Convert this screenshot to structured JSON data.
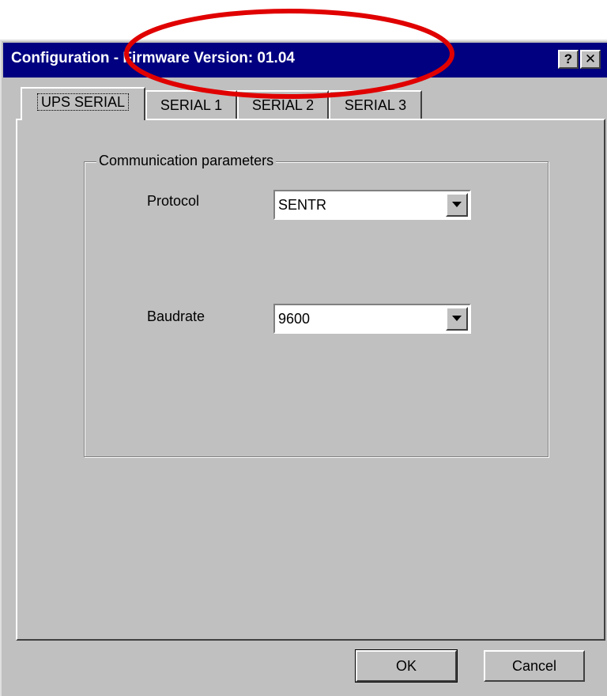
{
  "window": {
    "title": "Configuration - Firmware Version: 01.04",
    "help_button": "?",
    "close_button": "✕"
  },
  "tabs": [
    {
      "label": "UPS SERIAL",
      "active": true
    },
    {
      "label": "SERIAL 1",
      "active": false
    },
    {
      "label": "SERIAL 2",
      "active": false
    },
    {
      "label": "SERIAL 3",
      "active": false
    }
  ],
  "group": {
    "title": "Communication parameters",
    "protocol": {
      "label": "Protocol",
      "value": "SENTR"
    },
    "baudrate": {
      "label": "Baudrate",
      "value": "9600"
    }
  },
  "buttons": {
    "ok": "OK",
    "cancel": "Cancel"
  },
  "annotation": {
    "shape": "ellipse",
    "color": "#e00000"
  }
}
